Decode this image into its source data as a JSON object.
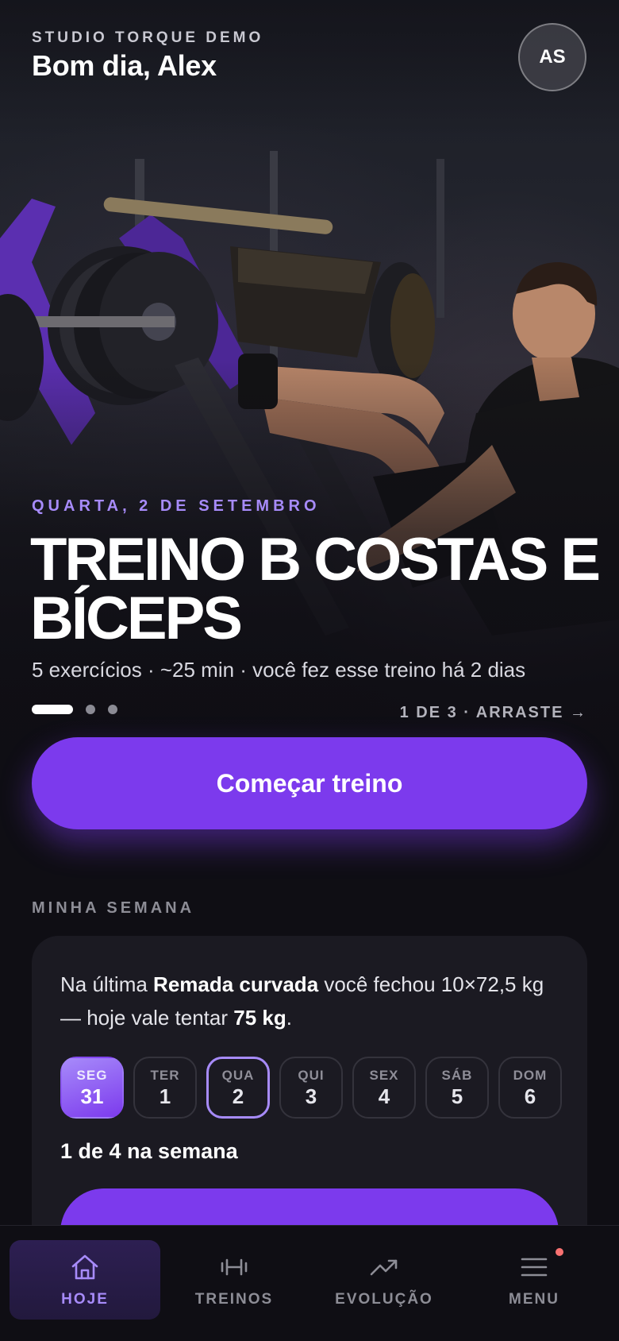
{
  "header": {
    "brand": "STUDIO TORQUE DEMO",
    "greeting": "Bom dia, Alex",
    "avatar_initials": "AS"
  },
  "hero": {
    "date": "QUARTA, 2 DE SETEMBRO",
    "title": "TREINO B COSTAS E BÍCEPS",
    "meta": "5 exercícios · ~25 min · você fez esse treino há 2 dias",
    "pager": "1 DE 3 · ARRASTE →",
    "slide_current": 1,
    "slide_total": 3,
    "cta_label": "Começar treino"
  },
  "week": {
    "section_label": "MINHA SEMANA",
    "tip_prefix": "Na última ",
    "tip_exercise": "Remada curvada",
    "tip_middle": " você fechou 10×72,5 kg — hoje vale tentar ",
    "tip_target": "75 kg",
    "tip_suffix": ".",
    "days": [
      {
        "name": "SEG",
        "date": "31",
        "state": "done"
      },
      {
        "name": "TER",
        "date": "1",
        "state": "idle"
      },
      {
        "name": "QUA",
        "date": "2",
        "state": "today"
      },
      {
        "name": "QUI",
        "date": "3",
        "state": "idle"
      },
      {
        "name": "SEX",
        "date": "4",
        "state": "idle"
      },
      {
        "name": "SÁB",
        "date": "5",
        "state": "idle"
      },
      {
        "name": "DOM",
        "date": "6",
        "state": "idle"
      }
    ],
    "progress": "1 de 4 na semana"
  },
  "tabs": [
    {
      "label": "HOJE",
      "icon": "home-icon",
      "active": true
    },
    {
      "label": "TREINOS",
      "icon": "dumbbell-icon",
      "active": false
    },
    {
      "label": "EVOLUÇÃO",
      "icon": "trend-up-icon",
      "active": false
    },
    {
      "label": "MENU",
      "icon": "menu-icon",
      "active": false,
      "notification": true
    }
  ],
  "colors": {
    "accent": "#7c3aed",
    "accent_light": "#a78bfa",
    "background": "#0f0e14",
    "card": "#1b1a22",
    "notification": "#f87171"
  }
}
